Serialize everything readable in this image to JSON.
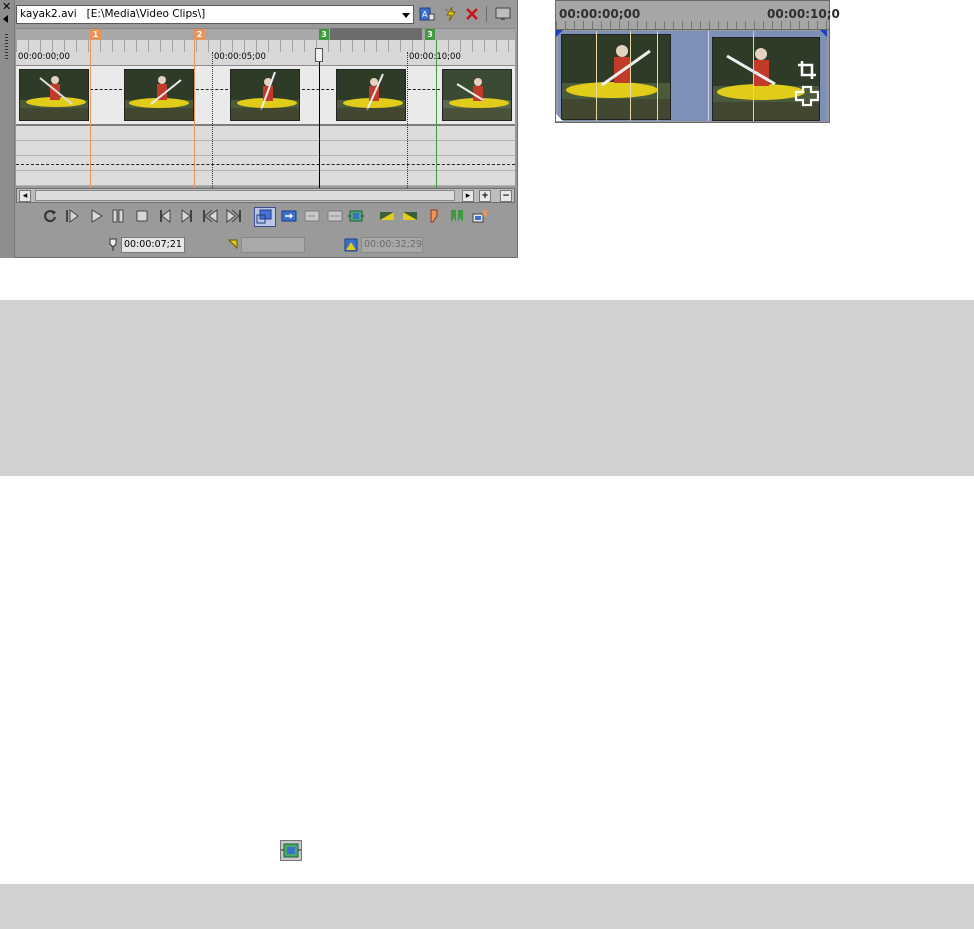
{
  "trimmer": {
    "file_name": "kayak2.avi",
    "file_path": "[E:\\Media\\Video Clips\\]",
    "markers": [
      {
        "label": "1"
      },
      {
        "label": "2"
      }
    ],
    "regions": [
      {
        "label": "3"
      },
      {
        "label": "3"
      }
    ],
    "ruler_labels": [
      "00:00:00;00",
      "00:00:05;00",
      "00:00:10;00"
    ],
    "cursor_time": "00:00:07;21",
    "selection_start": "",
    "selection_length": "00:00:32;29"
  },
  "preview": {
    "ruler_labels": [
      "00:00:00;00",
      "00:00:10;0"
    ]
  },
  "icons": {
    "toolbar": [
      "add-to-project-icon",
      "auto-ripple-icon",
      "delete-icon",
      "monitor-icon"
    ],
    "transport": [
      "loop-icon",
      "play-from-start-icon",
      "play-icon",
      "pause-icon",
      "stop-icon",
      "previous-frame-icon",
      "next-frame-icon",
      "step-back-icon",
      "step-forward-icon",
      "select-mode-icon",
      "add-to-timeline-icon",
      "insert-icon",
      "fit-icon",
      "trim-frame-icon",
      "fade-in-icon",
      "fade-out-icon",
      "marker-icon",
      "region-icon",
      "snapshot-icon"
    ]
  },
  "colors": {
    "marker": "#e8955c",
    "region": "#3f9a3f",
    "window": "#9a9a9a"
  }
}
